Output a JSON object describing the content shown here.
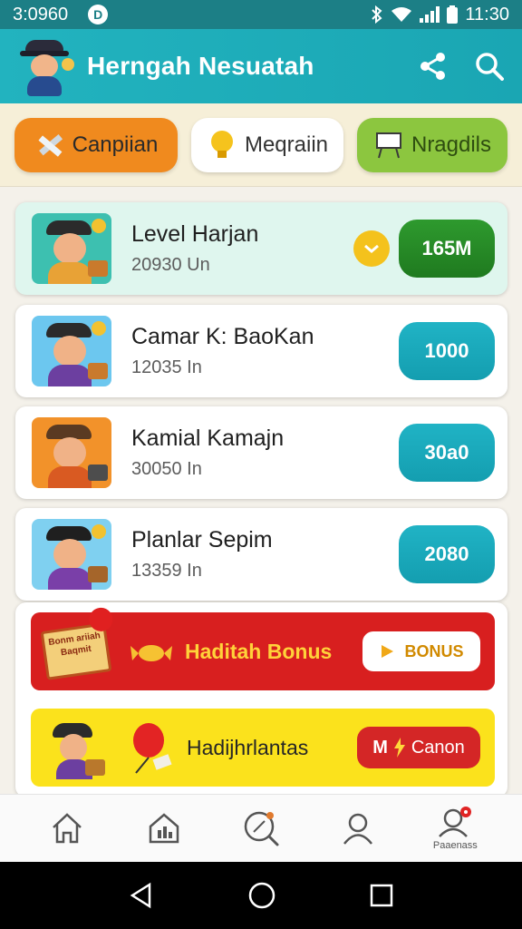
{
  "status_bar": {
    "time_left": "3:0960",
    "badge": "D",
    "time_right": "11:30"
  },
  "app_bar": {
    "title": "Herngah Nesuatah",
    "share_icon": "share-icon",
    "search_icon": "search-icon"
  },
  "tabs": [
    {
      "label": "Canpiian",
      "icon": "pencil-ruler-icon",
      "color": "#f08a1e"
    },
    {
      "label": "Meqraiin",
      "icon": "lightbulb-icon",
      "color": "#ffffff"
    },
    {
      "label": "Nragdils",
      "icon": "easel-icon",
      "color": "#8cc63f"
    }
  ],
  "list": [
    {
      "name": "Level Harjan",
      "sub": "20930 Un",
      "value": "165M",
      "selected": true
    },
    {
      "name": "Camar K: BaoKan",
      "sub": "12035 In",
      "value": "1000",
      "selected": false
    },
    {
      "name": "Kamial Kamajn",
      "sub": "30050 In",
      "value": "30a0",
      "selected": false
    },
    {
      "name": "Planlar Sepim",
      "sub": "13359 In",
      "value": "2080",
      "selected": false
    }
  ],
  "promo_red": {
    "box_text": "Bonm ariiah Baqmit",
    "title": "Haditah Bonus",
    "button": "BONUS"
  },
  "promo_yellow": {
    "title": "Hadijhrlantas",
    "button": "Canon",
    "button_prefix": "M"
  },
  "bottom_nav": [
    {
      "icon": "home-icon",
      "label": ""
    },
    {
      "icon": "shop-icon",
      "label": ""
    },
    {
      "icon": "search-map-icon",
      "label": ""
    },
    {
      "icon": "profile-icon",
      "label": ""
    },
    {
      "icon": "account-badge-icon",
      "label": "Paaenass"
    }
  ],
  "colors": {
    "primary": "#1aa6b3",
    "accent_green": "#1f7a1f",
    "accent_red": "#d81f1f",
    "accent_yellow": "#fbe21c"
  }
}
